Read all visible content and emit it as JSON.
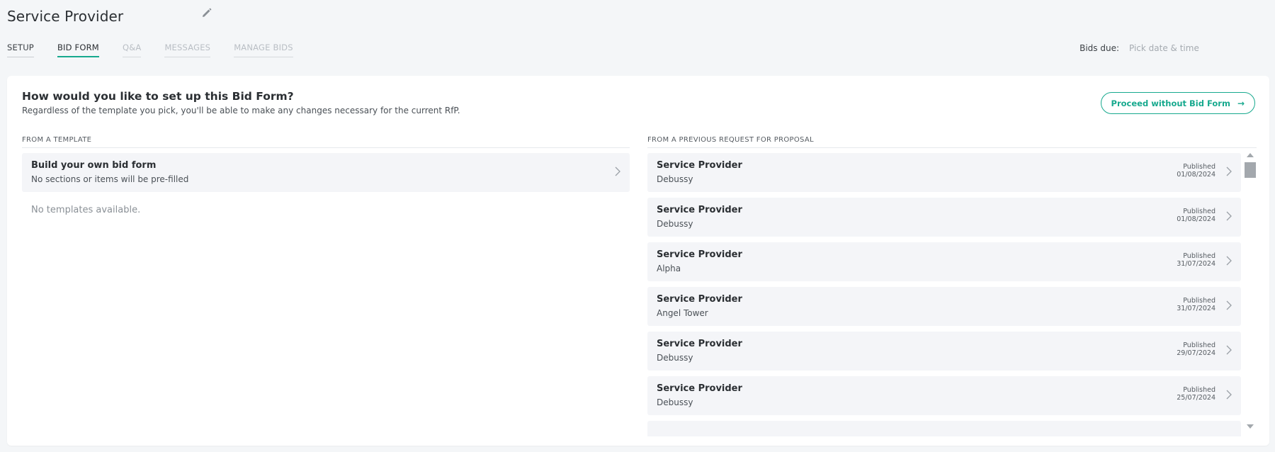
{
  "header": {
    "title": "Service Provider",
    "edit_icon": "pencil-icon"
  },
  "tabs": [
    {
      "label": "SETUP",
      "state": "normal"
    },
    {
      "label": "BID FORM",
      "state": "active"
    },
    {
      "label": "Q&A",
      "state": "disabled"
    },
    {
      "label": "MESSAGES",
      "state": "disabled"
    },
    {
      "label": "MANAGE BIDS",
      "state": "disabled"
    }
  ],
  "bids_due": {
    "label": "Bids due:",
    "placeholder": "Pick date & time"
  },
  "setup_card": {
    "heading": "How would you like to set up this Bid Form?",
    "subheading": "Regardless of the template you pick, you'll be able to make any changes necessary for the current RfP.",
    "proceed_button": "Proceed without Bid Form",
    "proceed_icon": "arrow-right-icon"
  },
  "template_section": {
    "label": "FROM A TEMPLATE",
    "build_own": {
      "title": "Build your own bid form",
      "subtitle": "No sections or items will be pre-filled"
    },
    "empty_message": "No templates available."
  },
  "previous_section": {
    "label": "FROM A PREVIOUS REQUEST FOR PROPOSAL",
    "published_label": "Published",
    "items": [
      {
        "title": "Service Provider",
        "subtitle": "Debussy",
        "date": "01/08/2024"
      },
      {
        "title": "Service Provider",
        "subtitle": "Debussy",
        "date": "01/08/2024"
      },
      {
        "title": "Service Provider",
        "subtitle": "Alpha",
        "date": "31/07/2024"
      },
      {
        "title": "Service Provider",
        "subtitle": "Angel Tower",
        "date": "31/07/2024"
      },
      {
        "title": "Service Provider",
        "subtitle": "Debussy",
        "date": "29/07/2024"
      },
      {
        "title": "Service Provider",
        "subtitle": "Debussy",
        "date": "25/07/2024"
      }
    ]
  },
  "colors": {
    "accent": "#17a98e",
    "background": "#f4f6f8",
    "row_background": "#f4f5f8"
  }
}
